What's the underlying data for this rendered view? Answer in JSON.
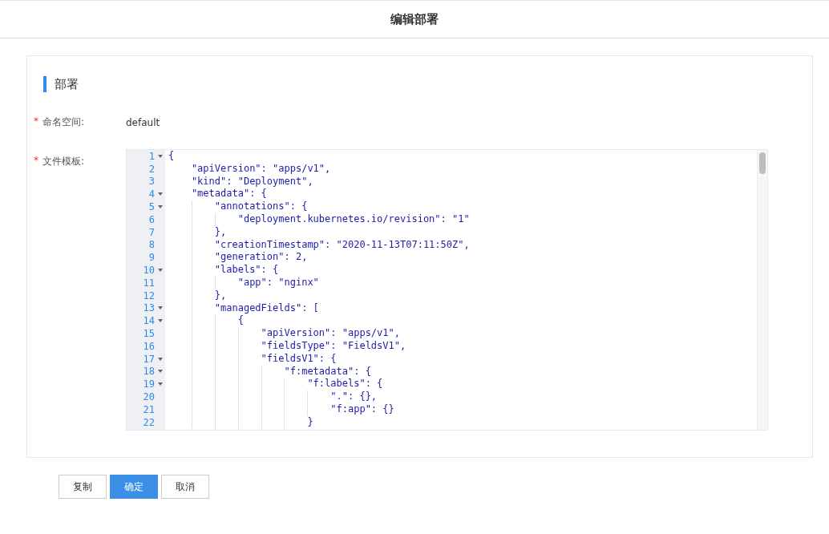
{
  "header": {
    "title": "编辑部署"
  },
  "section": {
    "title": "部署"
  },
  "fields": [
    {
      "label": "命名空间:",
      "required_mark": "*",
      "value": "default"
    }
  ],
  "editor": {
    "label": "文件模板:",
    "required_mark": "*",
    "lines": [
      {
        "number": "1",
        "foldable": true,
        "text": "{"
      },
      {
        "number": "2",
        "foldable": false,
        "text": "    \"apiVersion\": \"apps/v1\","
      },
      {
        "number": "3",
        "foldable": false,
        "text": "    \"kind\": \"Deployment\","
      },
      {
        "number": "4",
        "foldable": true,
        "text": "    \"metadata\": {"
      },
      {
        "number": "5",
        "foldable": true,
        "text": "        \"annotations\": {"
      },
      {
        "number": "6",
        "foldable": false,
        "text": "            \"deployment.kubernetes.io/revision\": \"1\""
      },
      {
        "number": "7",
        "foldable": false,
        "text": "        },"
      },
      {
        "number": "8",
        "foldable": false,
        "text": "        \"creationTimestamp\": \"2020-11-13T07:11:50Z\","
      },
      {
        "number": "9",
        "foldable": false,
        "text": "        \"generation\": 2,"
      },
      {
        "number": "10",
        "foldable": true,
        "text": "        \"labels\": {"
      },
      {
        "number": "11",
        "foldable": false,
        "text": "            \"app\": \"nginx\""
      },
      {
        "number": "12",
        "foldable": false,
        "text": "        },"
      },
      {
        "number": "13",
        "foldable": true,
        "text": "        \"managedFields\": ["
      },
      {
        "number": "14",
        "foldable": true,
        "text": "            {"
      },
      {
        "number": "15",
        "foldable": false,
        "text": "                \"apiVersion\": \"apps/v1\","
      },
      {
        "number": "16",
        "foldable": false,
        "text": "                \"fieldsType\": \"FieldsV1\","
      },
      {
        "number": "17",
        "foldable": true,
        "text": "                \"fieldsV1\": {"
      },
      {
        "number": "18",
        "foldable": true,
        "text": "                    \"f:metadata\": {"
      },
      {
        "number": "19",
        "foldable": true,
        "text": "                        \"f:labels\": {"
      },
      {
        "number": "20",
        "foldable": false,
        "text": "                            \".\": {},"
      },
      {
        "number": "21",
        "foldable": false,
        "text": "                            \"f:app\": {}"
      },
      {
        "number": "22",
        "foldable": false,
        "text": "                        }"
      }
    ]
  },
  "buttons": [
    {
      "label": "复制",
      "kind": "default"
    },
    {
      "label": "确定",
      "kind": "primary"
    },
    {
      "label": "取消",
      "kind": "default"
    }
  ]
}
